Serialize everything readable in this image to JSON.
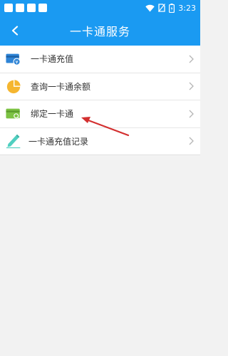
{
  "status_bar": {
    "time": "3:23",
    "icons": [
      "wifi-icon",
      "no-sim-icon",
      "battery-icon"
    ]
  },
  "header": {
    "title": "一卡通服务",
    "back_icon": "back-arrow-icon"
  },
  "menu": {
    "items": [
      {
        "label": "一卡通充值",
        "icon": "card-recharge-icon",
        "color": "#2e84d6"
      },
      {
        "label": "查询一卡通余额",
        "icon": "pie-chart-icon",
        "color": "#f5b630"
      },
      {
        "label": "绑定一卡通",
        "icon": "bind-card-icon",
        "color": "#7cc243"
      },
      {
        "label": "一卡通充值记录",
        "icon": "pencil-record-icon",
        "color": "#4fcfc0"
      }
    ]
  },
  "colors": {
    "accent": "#1a9af2",
    "annotation_arrow": "#d32f2f"
  }
}
